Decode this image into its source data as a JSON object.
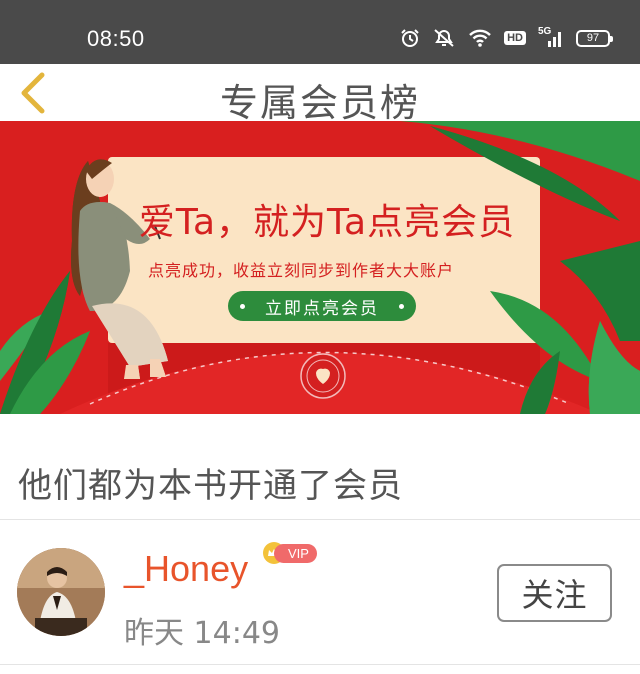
{
  "status_bar": {
    "time": "08:50",
    "icons": [
      "alarm-icon",
      "mute-icon",
      "wifi-icon",
      "hd-icon",
      "signal-5g-icon",
      "battery-icon"
    ],
    "hd_label": "HD",
    "network_label": "5G",
    "battery_level": "97"
  },
  "header": {
    "title": "专属会员榜",
    "back_icon": "chevron-left-icon",
    "accent_color": "#e3b53c"
  },
  "banner": {
    "headline": "爱Ta，就为Ta点亮会员",
    "subtitle": "点亮成功，收益立刻同步到作者大大账户",
    "cta_label": "立即点亮会员",
    "background_color": "#d91f1f",
    "card_color": "#fbe4c4",
    "cta_color": "#2d8c3c"
  },
  "section": {
    "title": "他们都为本书开通了会员"
  },
  "members": [
    {
      "name": "_Honey",
      "badge": "VIP",
      "time": "昨天 14:49",
      "follow_label": "关注",
      "name_color": "#e8542b"
    }
  ]
}
